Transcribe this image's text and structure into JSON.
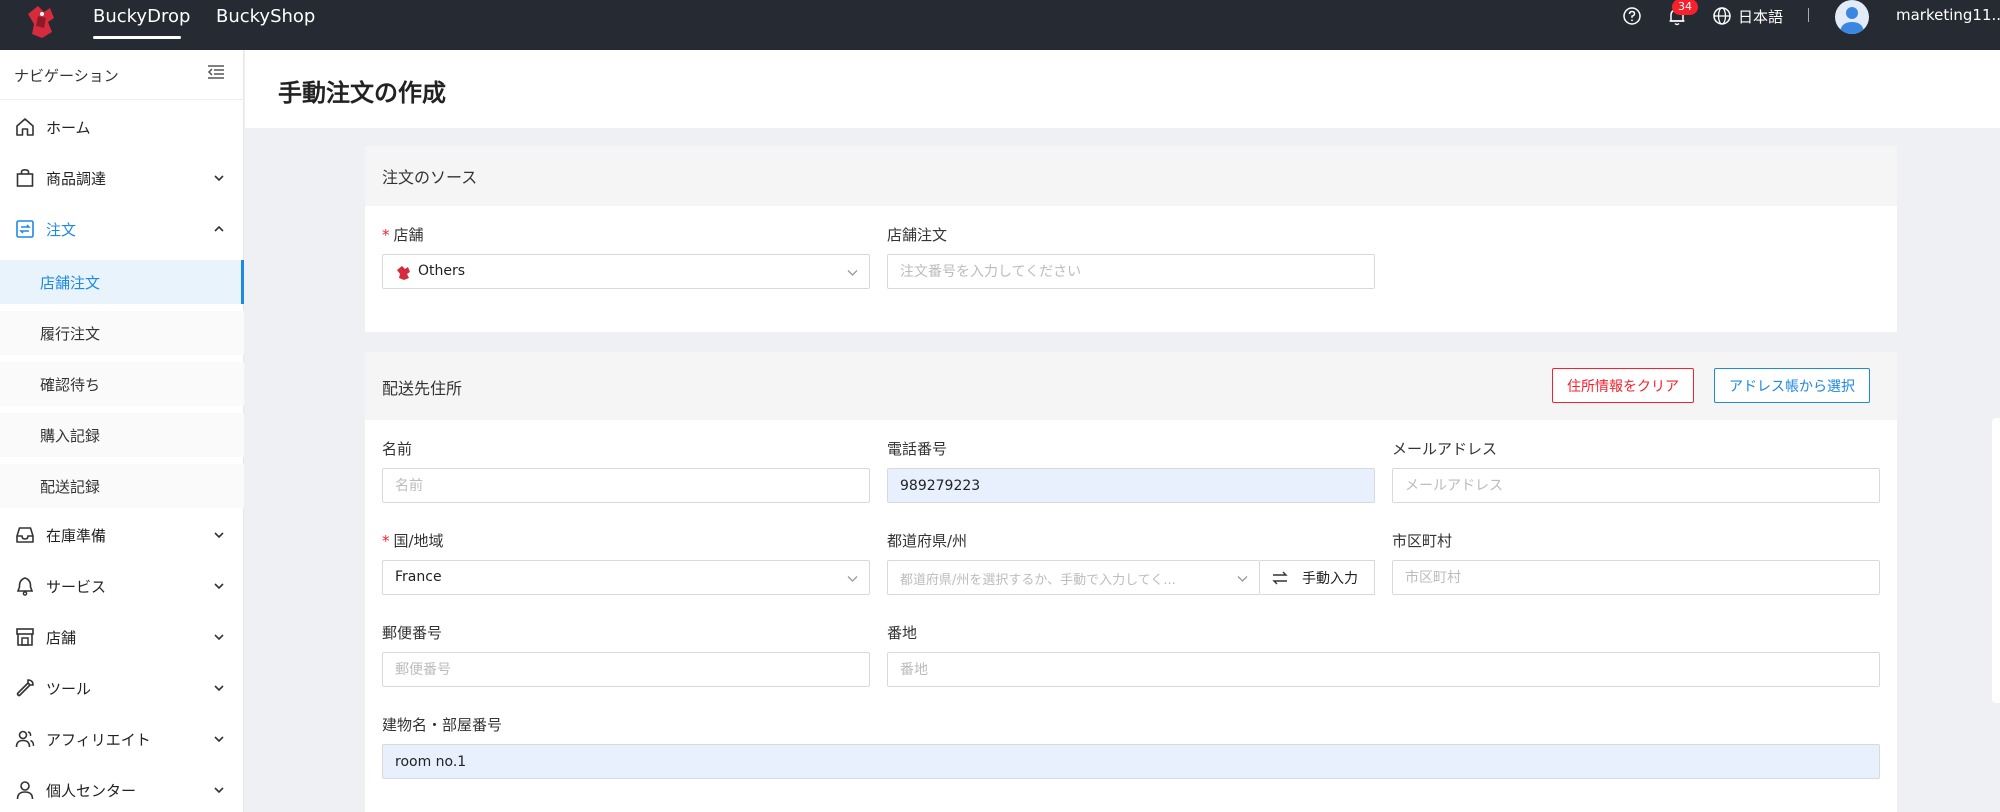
{
  "topbar": {
    "nav": [
      "BuckyDrop",
      "BuckyShop"
    ],
    "notification_count": "34",
    "language": "日本語",
    "user_name": "marketing11..."
  },
  "sidebar": {
    "header": "ナビゲーション",
    "items": {
      "home": "ホーム",
      "procurement": "商品調達",
      "orders": "注文",
      "store_orders": "店舗注文",
      "fulfillment_orders": "履行注文",
      "pending_confirmation": "確認待ち",
      "purchase_records": "購入記録",
      "shipping_records": "配送記録",
      "inventory": "在庫準備",
      "services": "サービス",
      "stores": "店舗",
      "tools": "ツール",
      "affiliate": "アフィリエイト",
      "personal_center": "個人センター"
    }
  },
  "page": {
    "title": "手動注文の作成"
  },
  "order_source": {
    "title": "注文のソース",
    "store_label": "店舗",
    "store_value": "Others",
    "store_order_label": "店舗注文",
    "store_order_placeholder": "注文番号を入力してください"
  },
  "shipping_address": {
    "title": "配送先住所",
    "clear_button": "住所情報をクリア",
    "address_book_button": "アドレス帳から選択",
    "name_label": "名前",
    "name_placeholder": "名前",
    "phone_label": "電話番号",
    "phone_value": "989279223",
    "email_label": "メールアドレス",
    "email_placeholder": "メールアドレス",
    "country_label": "国/地域",
    "country_value": "France",
    "state_label": "都道府県/州",
    "state_placeholder": "都道府県/州を選択するか、手動で入力してく...",
    "manual_input_button": "手動入力",
    "city_label": "市区町村",
    "city_placeholder": "市区町村",
    "postal_label": "郵便番号",
    "postal_placeholder": "郵便番号",
    "street_label": "番地",
    "street_placeholder": "番地",
    "building_label": "建物名・部屋番号",
    "building_value": "room no.1"
  },
  "colors": {
    "topbar": "#262a33",
    "accent": "#1e88e5",
    "danger": "#f5222d",
    "autofill": "#e8f0fe"
  }
}
